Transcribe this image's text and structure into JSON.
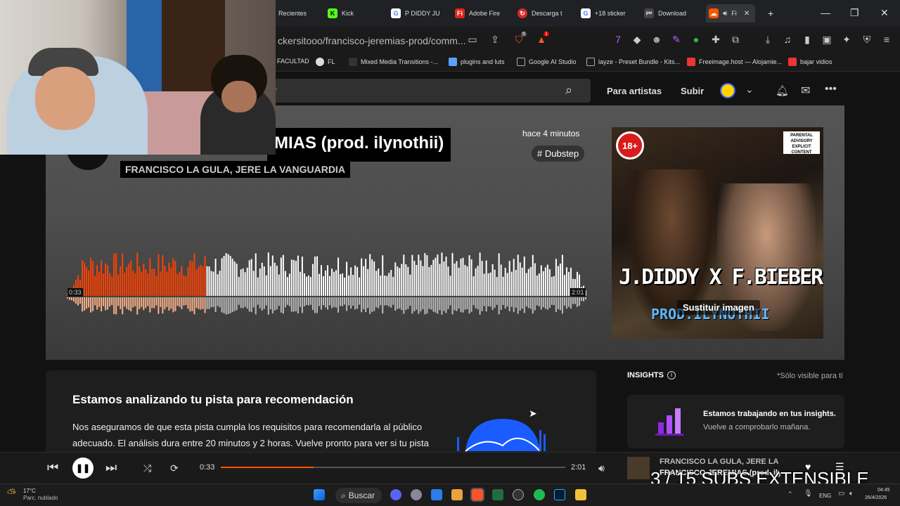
{
  "browser": {
    "tabs": [
      {
        "label": "Recientes",
        "color": "#888",
        "glyph": ""
      },
      {
        "label": "Kick",
        "color": "#53fc18",
        "glyph": "K"
      },
      {
        "label": "P DIDDY JU",
        "color": "#4285f4",
        "glyph": "G"
      },
      {
        "label": "Adobe Fire",
        "color": "#e1251b",
        "glyph": "Fi"
      },
      {
        "label": "Descarga t",
        "color": "#d62a2a",
        "glyph": "↻"
      },
      {
        "label": "+18 sticker",
        "color": "#4285f4",
        "glyph": "G"
      },
      {
        "label": "Download",
        "color": "#444",
        "glyph": "ꟷ"
      },
      {
        "label": "Fi",
        "color": "#ff5500",
        "glyph": "☁"
      }
    ],
    "new_tab": "+",
    "window_controls": {
      "minimize": "—",
      "restore": "❐",
      "close": "✕"
    },
    "url": "ckersitooo/francisco-jeremias-prod/comm...",
    "shield_badge": "5",
    "alert_badge": "1",
    "bookmarks": [
      "FACULTAD",
      "FL",
      "Mixed Media Transitions -...",
      "plugins and luts",
      "Google AI Studio",
      "layze - Preset Bundle - Kits...",
      "Freeimage.host — Alojamie...",
      "bajar vidios"
    ]
  },
  "soundcloud": {
    "search_placeholder": "r",
    "nav": {
      "for_artists": "Para artistas",
      "upload": "Subir"
    },
    "track": {
      "title_visible": "MIAS (prod. ilynothii)",
      "artists": "FRANCISCO LA GULA, JERE LA VANGUARDIA",
      "posted": "hace 4 minutos",
      "genre": "# Dubstep",
      "time_elapsed": "0:33",
      "duration": "2:01",
      "progress": 0.27,
      "cover_badge": "18+",
      "cover_advisory": "PARENTAL ADVISORY EXPLICIT CONTENT",
      "cover_title": "J.DIDDY X F.BIEBER",
      "cover_subtitle": "PROD.ILYNOTHII",
      "replace_image": "Sustituir imagen"
    },
    "analysis": {
      "title": "Estamos analizando tu pista para recomendación",
      "body": "Nos aseguramos de que esta pista cumpla los requisitos para recomendarla al público adecuado. El análisis dura entre 20 minutos y 2 horas. Vuelve pronto para ver si tu pista"
    },
    "insights": {
      "label": "INSIGHTS",
      "note": "*Sólo visible para ti",
      "heading": "Estamos trabajando en tus insights.",
      "sub": "Vuelve a comprobarlo mañana."
    },
    "player": {
      "current": "0:33",
      "duration": "2:01",
      "progress": 0.27,
      "now_playing_artist": "FRANCISCO LA GULA, JERE LA VANGUARDIA",
      "now_playing_title": "FRANCISCO JEREMIAS (prod. ilynothii)"
    }
  },
  "stream_overlay": "3 / 15 SUBS EXTENSIBLE",
  "taskbar": {
    "weather_temp": "17°C",
    "weather_desc": "Parc. nublado",
    "search": "Buscar",
    "lang": "ENG",
    "time": "04:45",
    "date": "26/4/2026"
  },
  "colors": {
    "accent": "#ff5500",
    "played": "#ff4000",
    "unplayed": "#ffffff"
  }
}
